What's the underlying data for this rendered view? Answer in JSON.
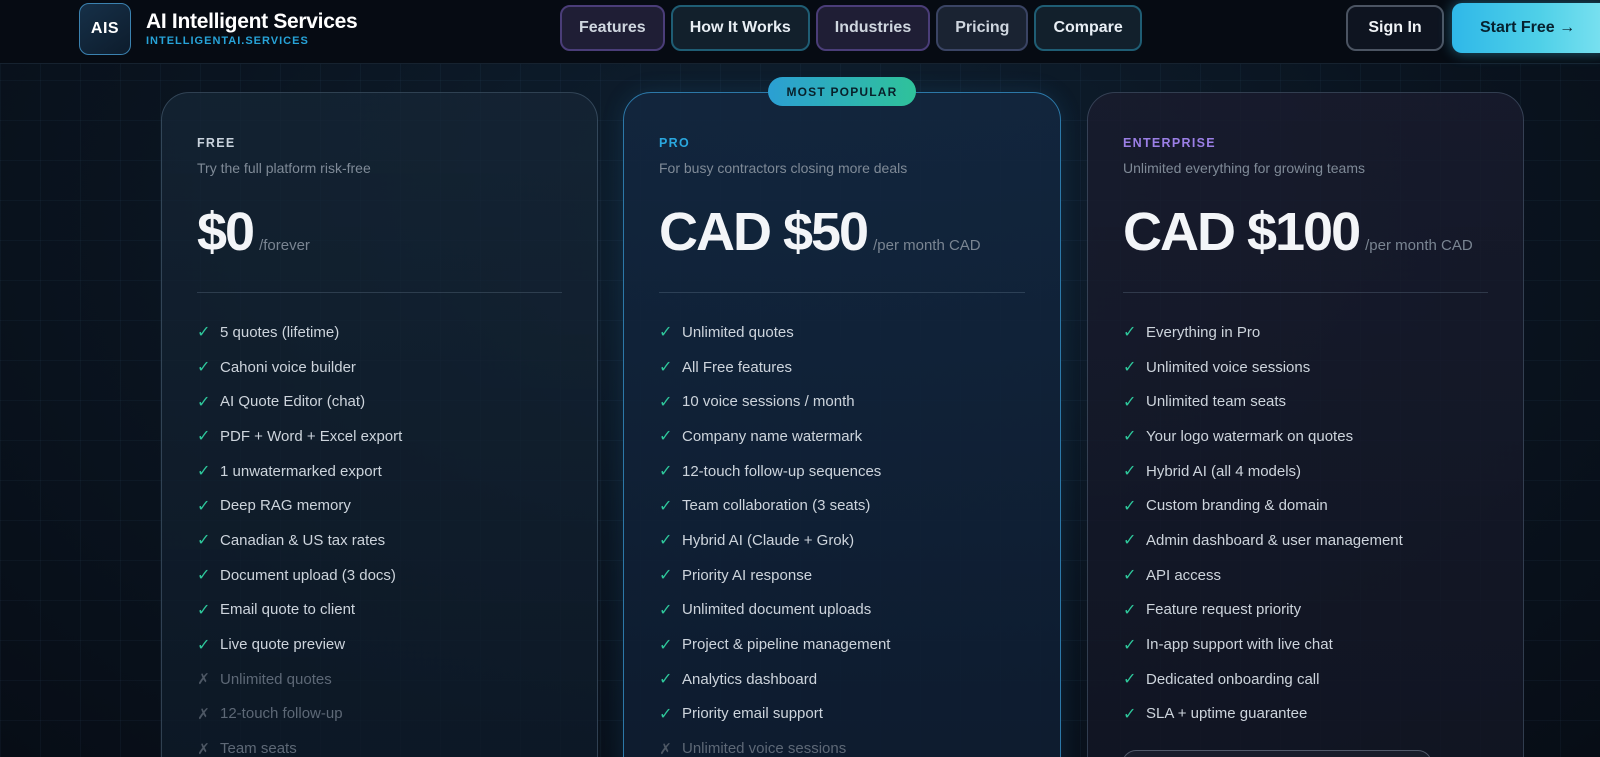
{
  "brand": {
    "logo_text": "AIS",
    "name": "AI Intelligent Services",
    "domain": "INTELLIGENTAI.SERVICES"
  },
  "nav": {
    "links": [
      "Features",
      "How It Works",
      "Industries",
      "Pricing",
      "Compare"
    ],
    "sign_in": "Sign In",
    "start_free": "Start Free →"
  },
  "colors": {
    "accent_cyan": "#2fb8e8",
    "check_green": "#2ec79b",
    "free_label": "#c9d3dd",
    "pro_label": "#2aa7de",
    "enterprise_label": "#9b7fe6"
  },
  "plans": [
    {
      "tier": "FREE",
      "description": "Try the full platform risk-free",
      "price": "$0",
      "period": "/forever",
      "features": [
        {
          "text": "5 quotes (lifetime)",
          "included": true,
          "icon": "check-icon"
        },
        {
          "text": "Cahoni voice builder",
          "included": true,
          "icon": "check-icon"
        },
        {
          "text": "AI Quote Editor (chat)",
          "included": true,
          "icon": "check-icon"
        },
        {
          "text": "PDF + Word + Excel export",
          "included": true,
          "icon": "check-icon"
        },
        {
          "text": "1 unwatermarked export",
          "included": true,
          "icon": "check-icon"
        },
        {
          "text": "Deep RAG memory",
          "included": true,
          "icon": "check-icon"
        },
        {
          "text": "Canadian & US tax rates",
          "included": true,
          "icon": "check-icon"
        },
        {
          "text": "Document upload (3 docs)",
          "included": true,
          "icon": "check-icon"
        },
        {
          "text": "Email quote to client",
          "included": true,
          "icon": "check-icon"
        },
        {
          "text": "Live quote preview",
          "included": true,
          "icon": "check-icon"
        },
        {
          "text": "Unlimited quotes",
          "included": false,
          "icon": "cross-icon"
        },
        {
          "text": "12-touch follow-up",
          "included": false,
          "icon": "cross-icon"
        },
        {
          "text": "Team seats",
          "included": false,
          "icon": "cross-icon"
        }
      ]
    },
    {
      "tier": "PRO",
      "badge": "MOST POPULAR",
      "description": "For busy contractors closing more deals",
      "price": "CAD $50",
      "period": "/per month CAD",
      "features": [
        {
          "text": "Unlimited quotes",
          "included": true,
          "icon": "check-icon"
        },
        {
          "text": "All Free features",
          "included": true,
          "icon": "check-icon"
        },
        {
          "text": "10 voice sessions / month",
          "included": true,
          "icon": "check-icon"
        },
        {
          "text": "Company name watermark",
          "included": true,
          "icon": "check-icon"
        },
        {
          "text": "12-touch follow-up sequences",
          "included": true,
          "icon": "check-icon"
        },
        {
          "text": "Team collaboration (3 seats)",
          "included": true,
          "icon": "check-icon"
        },
        {
          "text": "Hybrid AI (Claude + Grok)",
          "included": true,
          "icon": "check-icon"
        },
        {
          "text": "Priority AI response",
          "included": true,
          "icon": "check-icon"
        },
        {
          "text": "Unlimited document uploads",
          "included": true,
          "icon": "check-icon"
        },
        {
          "text": "Project & pipeline management",
          "included": true,
          "icon": "check-icon"
        },
        {
          "text": "Analytics dashboard",
          "included": true,
          "icon": "check-icon"
        },
        {
          "text": "Priority email support",
          "included": true,
          "icon": "check-icon"
        },
        {
          "text": "Unlimited voice sessions",
          "included": false,
          "icon": "cross-icon"
        }
      ]
    },
    {
      "tier": "ENTERPRISE",
      "description": "Unlimited everything for growing teams",
      "price": "CAD $100",
      "period": "/per month CAD",
      "features": [
        {
          "text": "Everything in Pro",
          "included": true,
          "icon": "check-icon"
        },
        {
          "text": "Unlimited voice sessions",
          "included": true,
          "icon": "check-icon"
        },
        {
          "text": "Unlimited team seats",
          "included": true,
          "icon": "check-icon"
        },
        {
          "text": "Your logo watermark on quotes",
          "included": true,
          "icon": "check-icon"
        },
        {
          "text": "Hybrid AI (all 4 models)",
          "included": true,
          "icon": "check-icon"
        },
        {
          "text": "Custom branding & domain",
          "included": true,
          "icon": "check-icon"
        },
        {
          "text": "Admin dashboard & user management",
          "included": true,
          "icon": "check-icon"
        },
        {
          "text": "API access",
          "included": true,
          "icon": "check-icon"
        },
        {
          "text": "Feature request priority",
          "included": true,
          "icon": "check-icon"
        },
        {
          "text": "In-app support with live chat",
          "included": true,
          "icon": "check-icon"
        },
        {
          "text": "Dedicated onboarding call",
          "included": true,
          "icon": "check-icon"
        },
        {
          "text": "SLA + uptime guarantee",
          "included": true,
          "icon": "check-icon"
        }
      ]
    }
  ]
}
